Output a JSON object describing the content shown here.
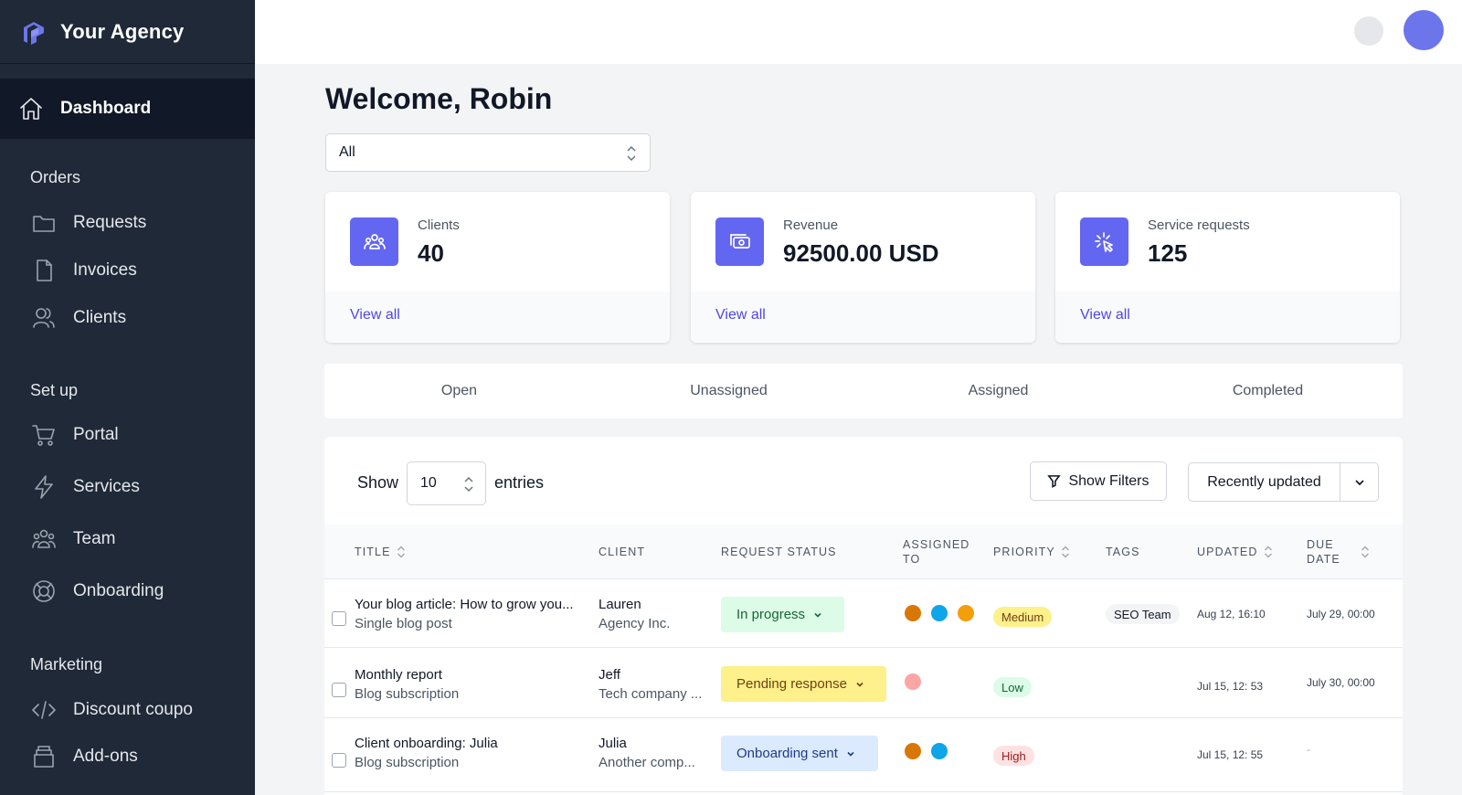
{
  "brand": {
    "name": "Your Agency"
  },
  "sidebar": {
    "active": {
      "label": "Dashboard",
      "icon": "home-icon"
    },
    "sections": [
      {
        "title": "Orders",
        "items": [
          {
            "label": "Requests",
            "icon": "folder-icon"
          },
          {
            "label": "Invoices",
            "icon": "document-icon"
          },
          {
            "label": "Clients",
            "icon": "users-icon"
          }
        ]
      },
      {
        "title": "Set up",
        "items": [
          {
            "label": "Portal",
            "icon": "cart-icon"
          },
          {
            "label": "Services",
            "icon": "lightning-icon"
          },
          {
            "label": "Team",
            "icon": "team-icon"
          },
          {
            "label": "Onboarding",
            "icon": "lifebuoy-icon"
          }
        ]
      },
      {
        "title": "Marketing",
        "items": [
          {
            "label": "Discount coupo",
            "icon": "code-icon"
          },
          {
            "label": "Add-ons",
            "icon": "archive-icon"
          }
        ]
      }
    ]
  },
  "main": {
    "welcome": "Welcome, Robin",
    "filter_select": "All",
    "cards": [
      {
        "label": "Clients",
        "value": "40",
        "link": "View all",
        "icon": "users-group-icon"
      },
      {
        "label": "Revenue",
        "value": "92500.00 USD",
        "link": "View all",
        "icon": "cash-icon"
      },
      {
        "label": "Service requests",
        "value": "125",
        "link": "View all",
        "icon": "cursor-click-icon"
      }
    ],
    "tabs": [
      "Open",
      "Unassigned",
      "Assigned",
      "Completed"
    ]
  },
  "table": {
    "show_label": "Show",
    "entries_value": "10",
    "entries_label": "entries",
    "filters_button": "Show Filters",
    "sort_button": "Recently updated",
    "columns": {
      "title": "Title",
      "client": "Client",
      "status": "Request status",
      "assigned_1": "Assigned",
      "assigned_2": "to",
      "priority": "Priority",
      "tags": "Tags",
      "updated": "Updated",
      "due_1": "Due",
      "due_2": "date"
    },
    "rows": [
      {
        "title": "Your blog article: How to grow you...",
        "subtitle": "Single blog post",
        "client": "Lauren",
        "company": "Agency Inc.",
        "status": "In progress",
        "priority": "Medium",
        "tag": "SEO Team",
        "updated": "Aug 12, 16:10",
        "due": "July 29, 00:00"
      },
      {
        "title": "Monthly report",
        "subtitle": "Blog subscription",
        "client": "Jeff",
        "company": "Tech company ...",
        "status": "Pending response",
        "priority": "Low",
        "tag": "",
        "updated": "Jul 15, 12: 53",
        "due": "July 30, 00:00"
      },
      {
        "title": "Client onboarding: Julia",
        "subtitle": "Blog subscription",
        "client": "Julia",
        "company": "Another comp...",
        "status": "Onboarding sent",
        "priority": "High",
        "tag": "",
        "updated": "Jul 15, 12: 55",
        "due": "-"
      }
    ]
  },
  "colors": {
    "sidebar_bg": "#1f2937",
    "accent": "#6366f1",
    "link": "#4f46e5",
    "status_in_progress_bg": "#dcfce7",
    "status_pending_bg": "#fef08a",
    "status_onboarding_bg": "#dbeafe",
    "priority_medium_bg": "#fef08a",
    "priority_low_bg": "#dcfce7",
    "priority_high_bg": "#fee2e2"
  }
}
